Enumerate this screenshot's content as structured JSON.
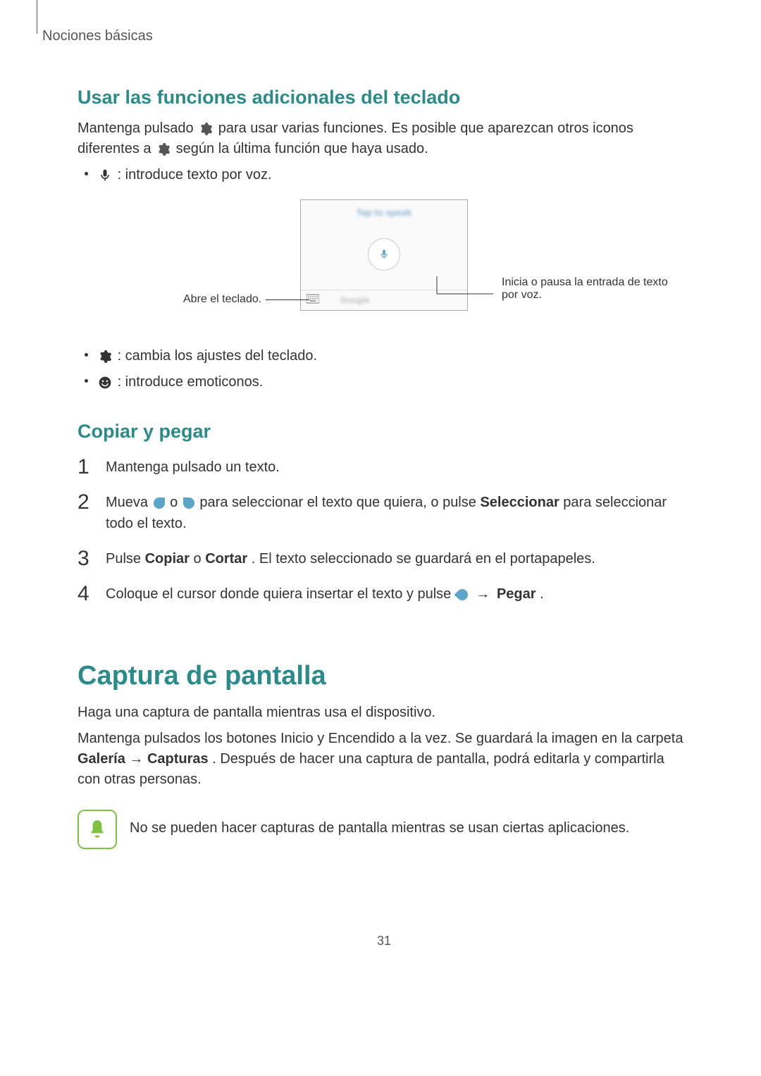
{
  "breadcrumb": "Nociones básicas",
  "section1": {
    "heading": "Usar las funciones adicionales del teclado",
    "intro_part1": "Mantenga pulsado ",
    "intro_part2": " para usar varias funciones. Es posible que aparezcan otros iconos diferentes a ",
    "intro_part3": " según la última función que haya usado.",
    "bullet_voice": " : introduce texto por voz.",
    "diagram_tap": "Tap to speak",
    "diagram_google": "Google",
    "callout_left": "Abre el teclado.",
    "callout_right": "Inicia o pausa la entrada de texto por voz.",
    "bullet_settings": " : cambia los ajustes del teclado.",
    "bullet_emoji": " : introduce emoticonos."
  },
  "section2": {
    "heading": "Copiar y pegar",
    "step1": "Mantenga pulsado un texto.",
    "step2_a": "Mueva ",
    "step2_b": " o ",
    "step2_c": " para seleccionar el texto que quiera, o pulse ",
    "step2_d": "Seleccionar",
    "step2_e": " para seleccionar todo el texto.",
    "step3_a": "Pulse ",
    "step3_b": "Copiar",
    "step3_c": " o ",
    "step3_d": "Cortar",
    "step3_e": ". El texto seleccionado se guardará en el portapapeles.",
    "step4_a": "Coloque el cursor donde quiera insertar el texto y pulse ",
    "step4_b": " → ",
    "step4_c": "Pegar",
    "step4_d": "."
  },
  "section3": {
    "heading": "Captura de pantalla",
    "p1": "Haga una captura de pantalla mientras usa el dispositivo.",
    "p2_a": "Mantenga pulsados los botones Inicio y Encendido a la vez. Se guardará la imagen en la carpeta ",
    "p2_b": "Galería",
    "p2_c": " → ",
    "p2_d": "Capturas",
    "p2_e": ". Después de hacer una captura de pantalla, podrá editarla y compartirla con otras personas.",
    "note": "No se pueden hacer capturas de pantalla mientras se usan ciertas aplicaciones."
  },
  "page_number": "31",
  "numbers": {
    "n1": "1",
    "n2": "2",
    "n3": "3",
    "n4": "4"
  }
}
